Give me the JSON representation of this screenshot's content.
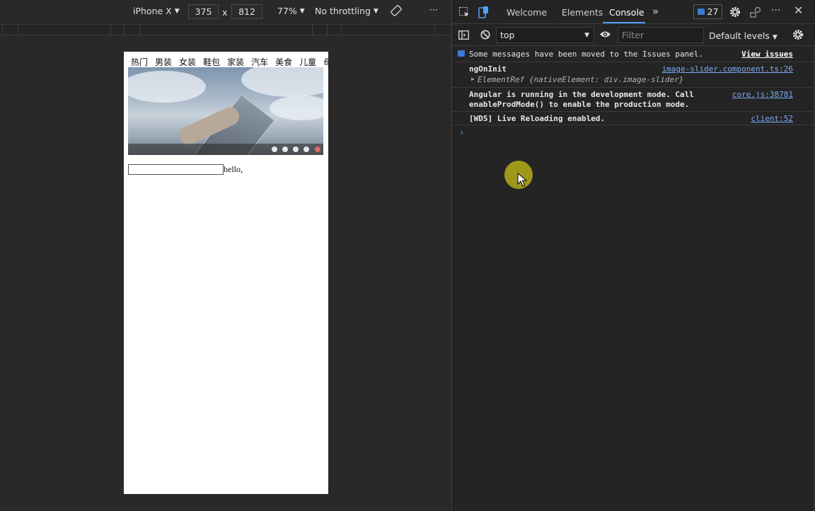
{
  "device_toolbar": {
    "device": "iPhone X",
    "width": "375",
    "times": "x",
    "height": "812",
    "zoom": "77%",
    "throttling": "No throttling",
    "more": "···"
  },
  "page": {
    "nav_tabs": [
      "热门",
      "男装",
      "女装",
      "鞋包",
      "家装",
      "汽车",
      "美食",
      "儿童",
      "母婴"
    ],
    "slider_dots": 5,
    "slider_active_dot": 4,
    "input_value": "",
    "greeting": "hello,"
  },
  "devtools": {
    "tabs": [
      {
        "label": "Welcome"
      },
      {
        "label": "Elements"
      },
      {
        "label": "Console"
      }
    ],
    "active_tab": "Console",
    "issues_count": "27",
    "context": "top",
    "filter_placeholder": "Filter",
    "levels": "Default levels",
    "messages": [
      {
        "text": "Some messages have been moved to the Issues panel.",
        "link": "View issues"
      },
      {
        "text": "ngOnInit",
        "detail": "ElementRef {nativeElement: div.image-slider}",
        "link": "image-slider.component.ts:26"
      },
      {
        "text": "Angular is running in the development mode. Call",
        "text2": "enableProdMode() to enable the production mode.",
        "link": "core.js:38781"
      },
      {
        "text": "[WDS] Live Reloading enabled.",
        "link": "client:52"
      }
    ],
    "prompt": "›"
  },
  "colors": {
    "accent": "#4da3ff",
    "link": "#7cacf8",
    "background": "#242424",
    "cursor_halo": "#c8be14"
  }
}
